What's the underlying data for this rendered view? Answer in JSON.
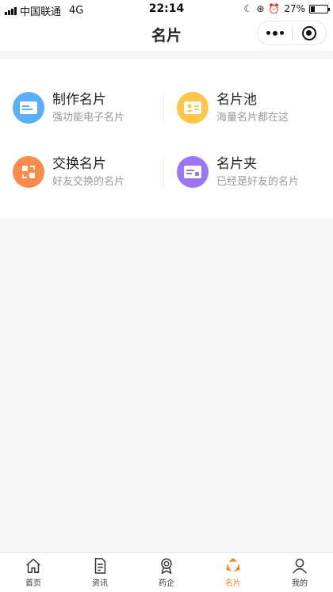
{
  "status_bar": {
    "carrier": "中国联通",
    "network": "4G",
    "time": "22:14",
    "battery_percent": "27%",
    "battery_level": 0.27
  },
  "nav": {
    "title": "名片"
  },
  "cards": [
    {
      "title": "制作名片",
      "subtitle": "强功能电子名片",
      "icon": "id-card-icon",
      "color": "#5aaef8"
    },
    {
      "title": "名片池",
      "subtitle": "海量名片都在这",
      "icon": "contact-card-icon",
      "color": "#fcc64a"
    },
    {
      "title": "交换名片",
      "subtitle": "好友交换的名片",
      "icon": "exchange-icon",
      "color": "#fb8b4a"
    },
    {
      "title": "名片夹",
      "subtitle": "已经是好友的名片",
      "icon": "card-holder-icon",
      "color": "#9b77f6"
    }
  ],
  "tabs": [
    {
      "label": "首页",
      "icon": "home-icon",
      "active": false
    },
    {
      "label": "资讯",
      "icon": "document-icon",
      "active": false
    },
    {
      "label": "药企",
      "icon": "badge-icon",
      "active": false
    },
    {
      "label": "名片",
      "icon": "card-share-icon",
      "active": true
    },
    {
      "label": "我的",
      "icon": "user-icon",
      "active": false
    }
  ],
  "colors": {
    "accent": "#f6841f",
    "background": "#f7f7f7"
  }
}
